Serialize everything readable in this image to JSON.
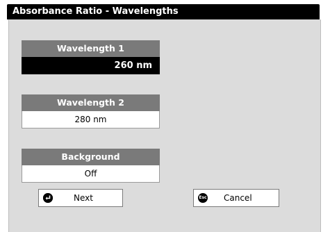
{
  "window": {
    "title": "Absorbance Ratio - Wavelengths"
  },
  "fields": [
    {
      "label": "Wavelength 1",
      "value": "260 nm"
    },
    {
      "label": "Wavelength 2",
      "value": "280 nm"
    },
    {
      "label": "Background",
      "value": "Off"
    }
  ],
  "buttons": {
    "next": {
      "label": "Next",
      "icon": "enter-arrow-icon"
    },
    "cancel": {
      "label": "Cancel",
      "icon": "esc-icon",
      "icon_text": "Esc"
    }
  },
  "colors": {
    "title_bg": "#000000",
    "panel_bg": "#dcdcdc",
    "field_header_bg": "#7a7a7a",
    "selected_bg": "#000000"
  }
}
